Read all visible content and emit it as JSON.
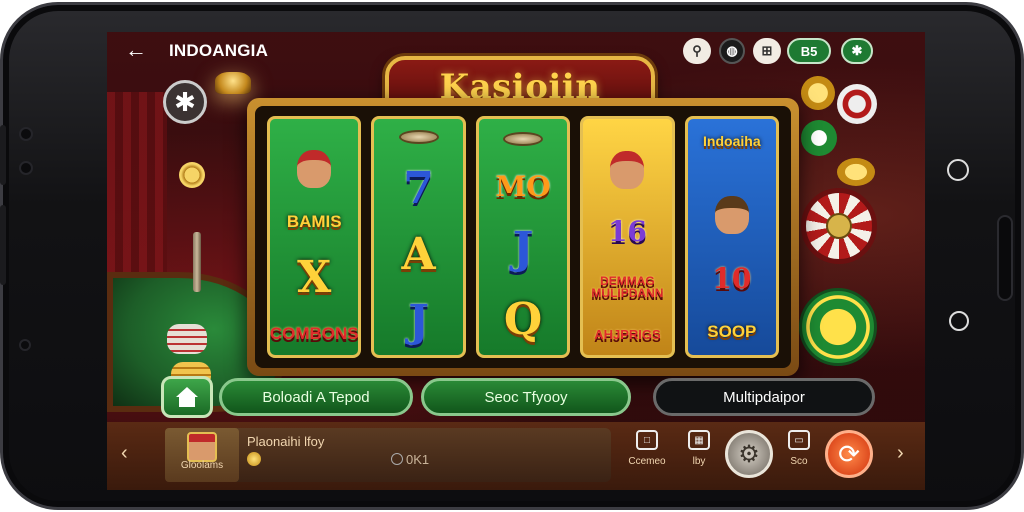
{
  "app": {
    "title": "INDOANGIA",
    "back_icon": "arrow-left-icon"
  },
  "header": {
    "pill_1": "⚲",
    "pill_2": "◍",
    "pill_3": "⊞",
    "pill_4": "B5",
    "pill_5": "✱"
  },
  "logo": {
    "text": "Kasioiin"
  },
  "reels": [
    {
      "color": "green",
      "symbols": [
        "BAMIS",
        "X",
        "COMBONS"
      ]
    },
    {
      "color": "green",
      "symbols": [
        "7",
        "A",
        "J"
      ]
    },
    {
      "color": "green",
      "symbols": [
        "MO",
        "J",
        "Q"
      ]
    },
    {
      "color": "gold",
      "symbols": [
        "16",
        "DEMMAG MULIPDANN",
        "AHJPRIGS"
      ]
    },
    {
      "color": "blue",
      "symbols": [
        "Indoaiha",
        "10",
        "SOOP"
      ]
    }
  ],
  "actions": {
    "home_icon": "house-icon",
    "button_1": "Boloadi A Tepod",
    "button_2": "Seoc Tfyooy",
    "button_3": "Multipdaipor"
  },
  "bottom_bar": {
    "game_thumb_label": "Gloolams",
    "game_title": "Plaonaihi lfoy",
    "game_count": "0K1",
    "item_1_label": "Ccemeo",
    "item_2_label": "lby",
    "item_4_label": "Sco",
    "gear_icon": "gear-icon",
    "spin_icon": "spin-icon"
  },
  "colors": {
    "accent_gold": "#e4bf52",
    "reel_green": "#1f9a39",
    "reel_gold": "#f5c03a",
    "reel_blue": "#2a72d8",
    "background_red": "#4d1216"
  }
}
